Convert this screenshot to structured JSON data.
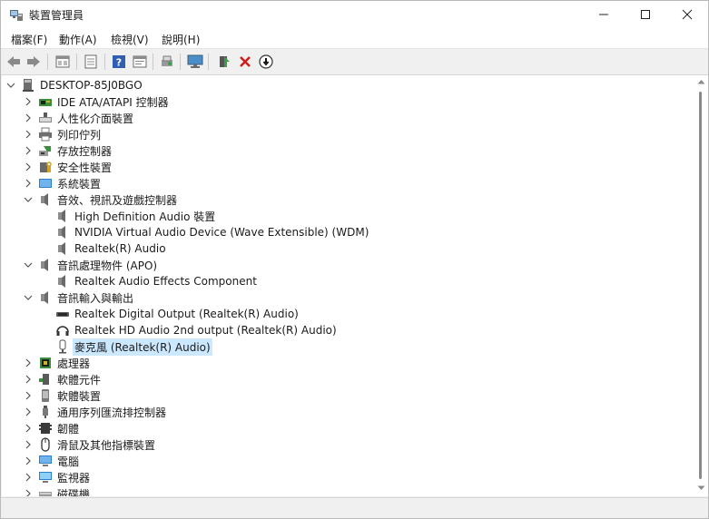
{
  "window": {
    "title": "裝置管理員"
  },
  "menubar": {
    "items": [
      "檔案(F)",
      "動作(A)",
      "檢視(V)",
      "說明(H)"
    ]
  },
  "toolbar": {
    "buttons": [
      "back-icon",
      "forward-icon",
      "properties-icon",
      "view-icon",
      "help-icon",
      "show-icon",
      "scan-icon",
      "monitor-icon",
      "update-driver-icon",
      "uninstall-icon",
      "disable-icon"
    ]
  },
  "tree": {
    "root": "DESKTOP-85J0BGO",
    "items": [
      {
        "label": "IDE ATA/ATAPI 控制器",
        "icon": "ide-controller-icon",
        "expanded": false
      },
      {
        "label": "人性化介面裝置",
        "icon": "hid-icon",
        "expanded": false
      },
      {
        "label": "列印佇列",
        "icon": "printer-icon",
        "expanded": false
      },
      {
        "label": "存放控制器",
        "icon": "storage-controller-icon",
        "expanded": false
      },
      {
        "label": "安全性裝置",
        "icon": "security-device-icon",
        "expanded": false
      },
      {
        "label": "系統裝置",
        "icon": "system-device-icon",
        "expanded": false
      },
      {
        "label": "音效、視訊及遊戲控制器",
        "icon": "speaker-icon",
        "expanded": true,
        "children": [
          "High Definition Audio 裝置",
          "NVIDIA Virtual Audio Device (Wave Extensible) (WDM)",
          "Realtek(R) Audio"
        ]
      },
      {
        "label": "音訊處理物件 (APO)",
        "icon": "speaker-icon",
        "expanded": true,
        "children": [
          "Realtek Audio Effects Component"
        ]
      },
      {
        "label": "音訊輸入與輸出",
        "icon": "speaker-icon",
        "expanded": true,
        "children": [
          "Realtek Digital Output (Realtek(R) Audio)",
          "Realtek HD Audio 2nd output (Realtek(R) Audio)",
          "麥克風 (Realtek(R) Audio)"
        ]
      },
      {
        "label": "處理器",
        "icon": "processor-icon",
        "expanded": false
      },
      {
        "label": "軟體元件",
        "icon": "software-component-icon",
        "expanded": false
      },
      {
        "label": "軟體裝置",
        "icon": "software-device-icon",
        "expanded": false
      },
      {
        "label": "通用序列匯流排控制器",
        "icon": "usb-icon",
        "expanded": false
      },
      {
        "label": "韌體",
        "icon": "firmware-icon",
        "expanded": false
      },
      {
        "label": "滑鼠及其他指標裝置",
        "icon": "mouse-icon",
        "expanded": false
      },
      {
        "label": "電腦",
        "icon": "computer-icon",
        "expanded": false
      },
      {
        "label": "監視器",
        "icon": "monitor-icon",
        "expanded": false
      },
      {
        "label": "磁碟機",
        "icon": "disk-drive-icon",
        "expanded": false
      }
    ],
    "selected": "麥克風 (Realtek(R) Audio)"
  },
  "colors": {
    "selection": "#cce8ff",
    "window_bg": "#f0f0f0",
    "tree_bg": "#ffffff"
  }
}
